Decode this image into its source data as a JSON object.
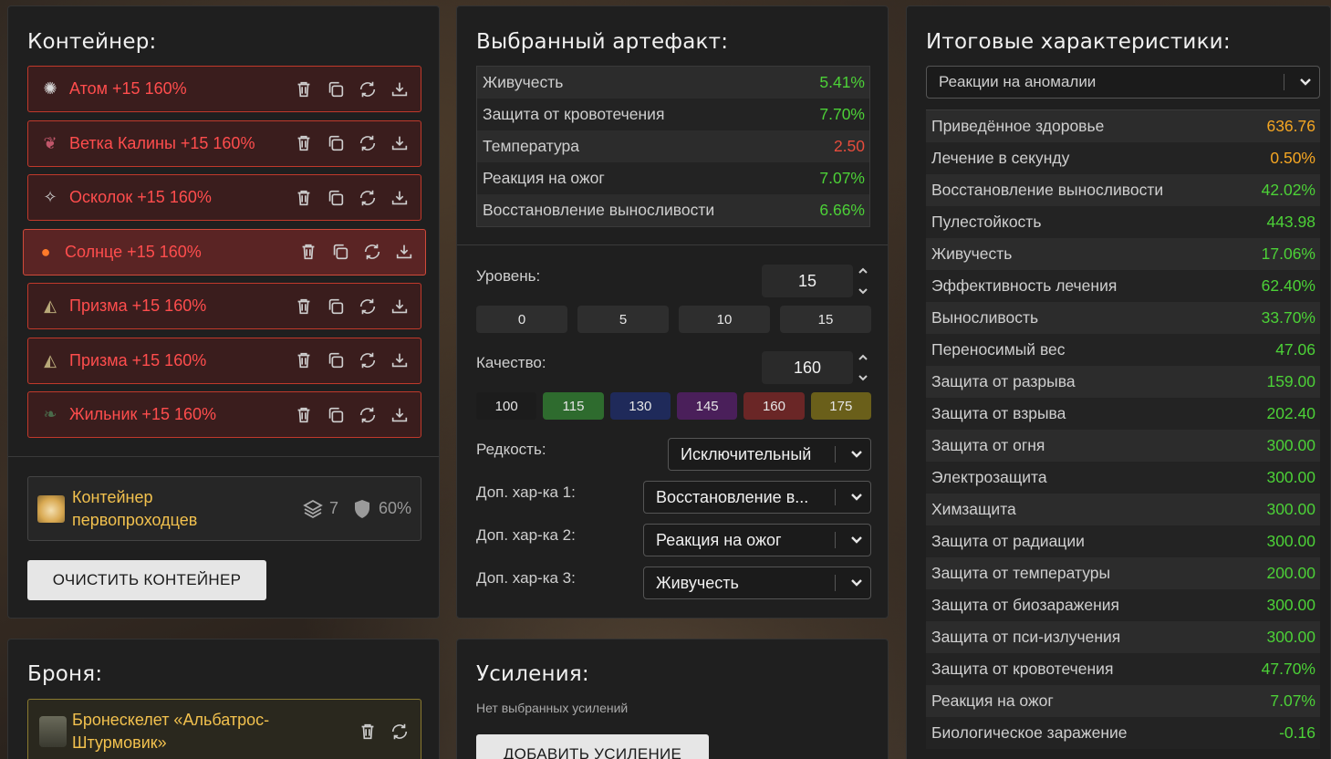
{
  "container_panel": {
    "title": "Контейнер:",
    "artifacts": [
      {
        "name": "Атом +15 160%",
        "icon": "atom-icon",
        "selected": false
      },
      {
        "name": "Ветка Калины +15 160%",
        "icon": "branch-icon",
        "selected": false
      },
      {
        "name": "Осколок +15 160%",
        "icon": "shard-icon",
        "selected": false
      },
      {
        "name": "Солнце +15 160%",
        "icon": "sun-icon",
        "selected": true
      },
      {
        "name": "Призма +15 160%",
        "icon": "prism-icon",
        "selected": false
      },
      {
        "name": "Призма +15 160%",
        "icon": "prism-icon",
        "selected": false
      },
      {
        "name": "Жильник +15 160%",
        "icon": "vein-icon",
        "selected": false
      }
    ],
    "container_card": {
      "name_line1": "Контейнер",
      "name_line2": "первопроходцев",
      "slots": "7",
      "protection": "60%"
    },
    "clear_button": "ОЧИСТИТЬ КОНТЕЙНЕР"
  },
  "armor_panel": {
    "title": "Броня:",
    "armor_line1": "Бронескелет «Альбатрос-",
    "armor_line2": "Штурмовик»"
  },
  "selected_panel": {
    "title": "Выбранный артефакт:",
    "stats": [
      {
        "name": "Живучесть",
        "value": "5.41%",
        "color": "green"
      },
      {
        "name": "Защита от кровотечения",
        "value": "7.70%",
        "color": "green"
      },
      {
        "name": "Температура",
        "value": "2.50",
        "color": "red"
      },
      {
        "name": "Реакция на ожог",
        "value": "7.07%",
        "color": "green"
      },
      {
        "name": "Восстановление выносливости",
        "value": "6.66%",
        "color": "green"
      }
    ],
    "level_label": "Уровень:",
    "level_value": "15",
    "level_presets": [
      "0",
      "5",
      "10",
      "15"
    ],
    "quality_label": "Качество:",
    "quality_value": "160",
    "quality_presets": [
      {
        "label": "100",
        "color": "#1c1c1c"
      },
      {
        "label": "115",
        "color": "#2e6b2e"
      },
      {
        "label": "130",
        "color": "#1f2a5a"
      },
      {
        "label": "145",
        "color": "#4a1f5a"
      },
      {
        "label": "160",
        "color": "#6a2626"
      },
      {
        "label": "175",
        "color": "#6a5f1a"
      }
    ],
    "rarity_label": "Редкость:",
    "rarity_value": "Исключительный",
    "extra1_label": "Доп. хар-ка 1:",
    "extra1_value": "Восстановление в...",
    "extra2_label": "Доп. хар-ка 2:",
    "extra2_value": "Реакция на ожог",
    "extra3_label": "Доп. хар-ка 3:",
    "extra3_value": "Живучесть"
  },
  "upgrades_panel": {
    "title": "Усиления:",
    "empty_text": "Нет выбранных усилений",
    "add_button": "ДОБАВИТЬ УСИЛЕНИЕ"
  },
  "totals_panel": {
    "title": "Итоговые характеристики:",
    "filter_value": "Реакции на аномалии",
    "stats": [
      {
        "name": "Приведённое здоровье",
        "value": "636.76",
        "color": "orange"
      },
      {
        "name": "Лечение в секунду",
        "value": "0.50%",
        "color": "orange"
      },
      {
        "name": "Восстановление выносливости",
        "value": "42.02%",
        "color": "green"
      },
      {
        "name": "Пулестойкость",
        "value": "443.98",
        "color": "green"
      },
      {
        "name": "Живучесть",
        "value": "17.06%",
        "color": "green"
      },
      {
        "name": "Эффективность лечения",
        "value": "62.40%",
        "color": "green"
      },
      {
        "name": "Выносливость",
        "value": "33.70%",
        "color": "green"
      },
      {
        "name": "Переносимый вес",
        "value": "47.06",
        "color": "green"
      },
      {
        "name": "Защита от разрыва",
        "value": "159.00",
        "color": "green"
      },
      {
        "name": "Защита от взрыва",
        "value": "202.40",
        "color": "green"
      },
      {
        "name": "Защита от огня",
        "value": "300.00",
        "color": "green"
      },
      {
        "name": "Электрозащита",
        "value": "300.00",
        "color": "green"
      },
      {
        "name": "Химзащита",
        "value": "300.00",
        "color": "green"
      },
      {
        "name": "Защита от радиации",
        "value": "300.00",
        "color": "green"
      },
      {
        "name": "Защита от температуры",
        "value": "200.00",
        "color": "green"
      },
      {
        "name": "Защита от биозаражения",
        "value": "300.00",
        "color": "green"
      },
      {
        "name": "Защита от пси-излучения",
        "value": "300.00",
        "color": "green"
      },
      {
        "name": "Защита от кровотечения",
        "value": "47.70%",
        "color": "green"
      },
      {
        "name": "Реакция на ожог",
        "value": "7.07%",
        "color": "green"
      },
      {
        "name": "Биологическое заражение",
        "value": "-0.16",
        "color": "green"
      }
    ]
  }
}
